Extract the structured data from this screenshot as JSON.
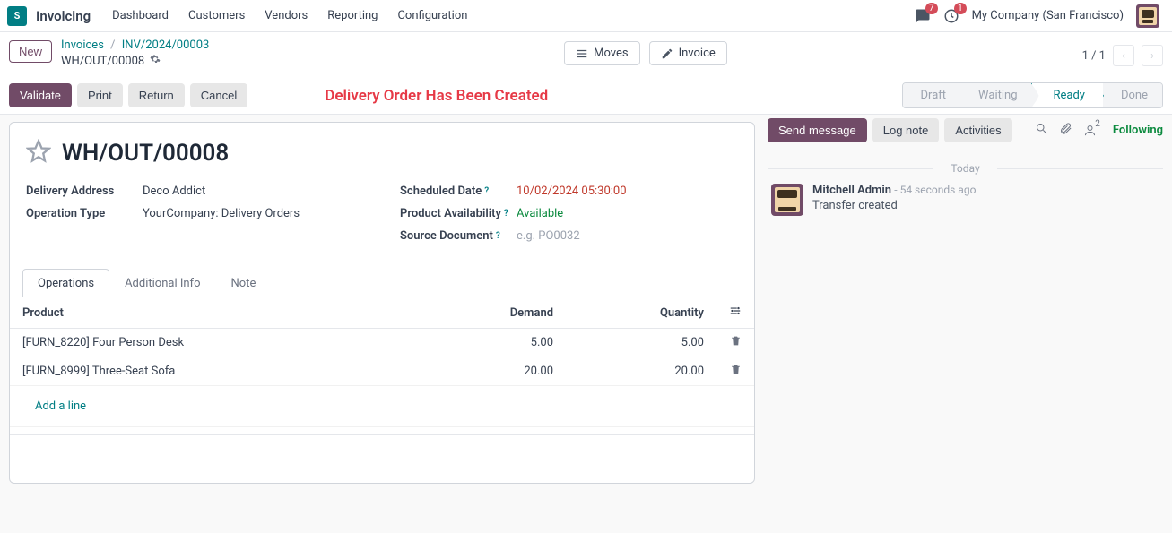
{
  "nav": {
    "app": "Invoicing",
    "menu": [
      "Dashboard",
      "Customers",
      "Vendors",
      "Reporting",
      "Configuration"
    ],
    "chat_badge": "7",
    "clock_badge": "1",
    "company": "My Company (San Francisco)"
  },
  "breadcrumb": {
    "new": "New",
    "l1a": "Invoices",
    "l1b": "INV/2024/00003",
    "l2": "WH/OUT/00008"
  },
  "ctrl": {
    "moves": "Moves",
    "invoice": "Invoice"
  },
  "pager": {
    "text": "1 / 1"
  },
  "actions": {
    "validate": "Validate",
    "print": "Print",
    "return": "Return",
    "cancel": "Cancel",
    "status_msg": "Delivery Order Has Been Created",
    "states": {
      "draft": "Draft",
      "waiting": "Waiting",
      "ready": "Ready",
      "done": "Done"
    }
  },
  "record": {
    "name": "WH/OUT/00008",
    "fields": {
      "delivery_address_l": "Delivery Address",
      "delivery_address": "Deco Addict",
      "operation_type_l": "Operation Type",
      "operation_type": "YourCompany: Delivery Orders",
      "scheduled_date_l": "Scheduled Date",
      "scheduled_date": "10/02/2024 05:30:00",
      "availability_l": "Product Availability",
      "availability": "Available",
      "source_doc_l": "Source Document",
      "source_doc_ph": "e.g. PO0032"
    }
  },
  "tabs": {
    "operations": "Operations",
    "addl": "Additional Info",
    "note": "Note"
  },
  "table": {
    "h_product": "Product",
    "h_demand": "Demand",
    "h_qty": "Quantity",
    "rows": [
      {
        "product": "[FURN_8220] Four Person Desk",
        "demand": "5.00",
        "qty": "5.00"
      },
      {
        "product": "[FURN_8999] Three-Seat Sofa",
        "demand": "20.00",
        "qty": "20.00"
      }
    ],
    "addline": "Add a line"
  },
  "chatter": {
    "send": "Send message",
    "log": "Log note",
    "act": "Activities",
    "follow": "Following",
    "follow_count": "2",
    "today": "Today",
    "msg": {
      "author": "Mitchell Admin",
      "time": "- 54 seconds ago",
      "body": "Transfer created"
    }
  }
}
